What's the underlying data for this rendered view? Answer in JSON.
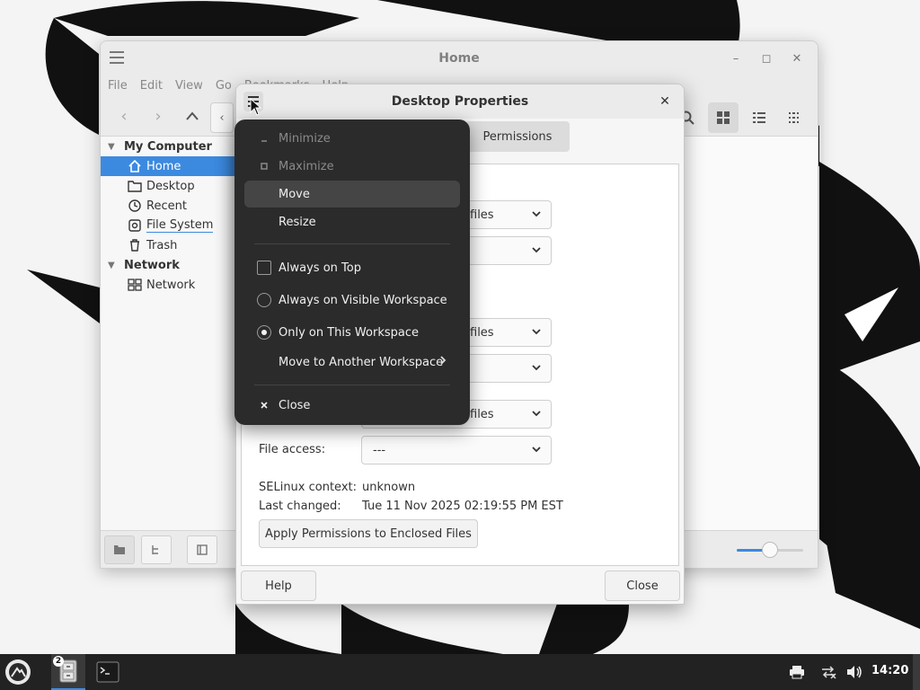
{
  "file_manager": {
    "title": "Home",
    "menu": [
      "File",
      "Edit",
      "View",
      "Go",
      "Bookmarks",
      "Help"
    ],
    "sidebar": {
      "sections": [
        {
          "label": "My Computer",
          "items": [
            {
              "label": "Home",
              "icon": "home-icon",
              "selected": true
            },
            {
              "label": "Desktop",
              "icon": "folder-icon"
            },
            {
              "label": "Recent",
              "icon": "clock-icon"
            },
            {
              "label": "File System",
              "icon": "drive-icon"
            },
            {
              "label": "Trash",
              "icon": "trash-icon"
            }
          ]
        },
        {
          "label": "Network",
          "items": [
            {
              "label": "Network",
              "icon": "network-icon"
            }
          ]
        }
      ]
    },
    "zoom_level": 0.5
  },
  "dialog": {
    "title": "Desktop Properties",
    "tab_permissions": "Permissions",
    "combo_files": "files",
    "file_access_label": "File access:",
    "file_access_value": "---",
    "selinux_label": "SELinux context:",
    "selinux_value": "unknown",
    "last_changed_label": "Last changed:",
    "last_changed_value": "Tue 11 Nov 2025 02:19:55 PM EST",
    "apply_button": "Apply Permissions to Enclosed Files",
    "help_button": "Help",
    "close_button": "Close"
  },
  "window_menu": {
    "minimize": "Minimize",
    "maximize": "Maximize",
    "move": "Move",
    "resize": "Resize",
    "always_on_top": "Always on Top",
    "always_on_visible_workspace": "Always on Visible Workspace",
    "only_on_this_workspace": "Only on This Workspace",
    "move_to_another_workspace": "Move to Another Workspace",
    "close": "Close"
  },
  "taskbar": {
    "clock": "14:20",
    "files_badge": "2"
  },
  "colors": {
    "accent": "#3c8ae0",
    "menu_bg": "#2b2b2b",
    "taskbar_bg": "#222222"
  }
}
